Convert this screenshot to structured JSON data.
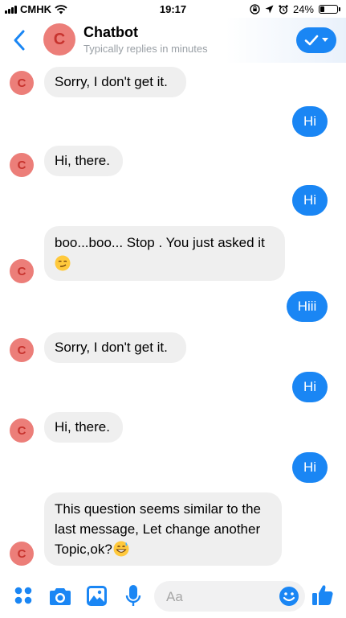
{
  "status_bar": {
    "carrier": "CMHK",
    "time": "19:17",
    "battery": "24%",
    "battery_level": 0.24
  },
  "header": {
    "avatar_letter": "C",
    "title": "Chatbot",
    "subtitle": "Typically replies in minutes"
  },
  "messages": [
    {
      "dir": "in",
      "text": "Sorry, I don't get it."
    },
    {
      "dir": "out",
      "text": "Hi"
    },
    {
      "dir": "in",
      "text": "Hi, there."
    },
    {
      "dir": "out",
      "text": "Hi"
    },
    {
      "dir": "in",
      "text": "boo...boo... Stop . You just asked it",
      "emoji": "smirking-face"
    },
    {
      "dir": "out",
      "text": "Hiii"
    },
    {
      "dir": "in",
      "text": "Sorry, I don't get it."
    },
    {
      "dir": "out",
      "text": "Hi"
    },
    {
      "dir": "in",
      "text": "Hi, there."
    },
    {
      "dir": "out",
      "text": "Hi"
    },
    {
      "dir": "in",
      "text": "This question seems similar to the last message, Let change another Topic,ok?",
      "emoji": "grinning-face-with-sweat"
    }
  ],
  "composer": {
    "placeholder": "Aa"
  },
  "colors": {
    "accent": "#1a86f4",
    "incoming_bubble": "#efefef",
    "avatar": "#ec7e79"
  }
}
